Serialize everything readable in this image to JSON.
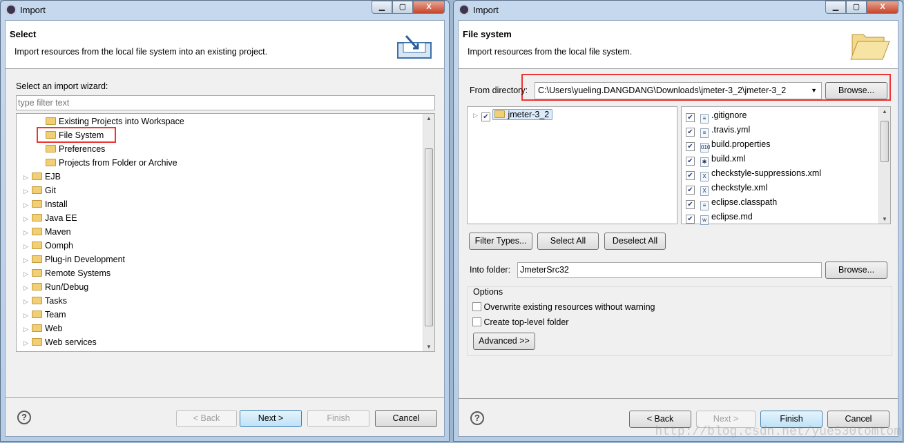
{
  "left": {
    "window_title": "Import",
    "header_title": "Select",
    "header_desc": "Import resources from the local file system into an existing project.",
    "wizard_label": "Select an import wizard:",
    "filter_placeholder": "type filter text",
    "tree": [
      {
        "label": "Existing Projects into Workspace",
        "child": true,
        "icon": "projects-icon"
      },
      {
        "label": "File System",
        "child": true,
        "icon": "folder-icon",
        "highlighted": true
      },
      {
        "label": "Preferences",
        "child": true,
        "icon": "preferences-icon"
      },
      {
        "label": "Projects from Folder or Archive",
        "child": true,
        "icon": "folder-icon"
      },
      {
        "label": "EJB"
      },
      {
        "label": "Git"
      },
      {
        "label": "Install"
      },
      {
        "label": "Java EE"
      },
      {
        "label": "Maven"
      },
      {
        "label": "Oomph"
      },
      {
        "label": "Plug-in Development"
      },
      {
        "label": "Remote Systems"
      },
      {
        "label": "Run/Debug"
      },
      {
        "label": "Tasks"
      },
      {
        "label": "Team"
      },
      {
        "label": "Web"
      },
      {
        "label": "Web services"
      }
    ],
    "buttons": {
      "back": "< Back",
      "next": "Next >",
      "finish": "Finish",
      "cancel": "Cancel"
    }
  },
  "right": {
    "window_title": "Import",
    "header_title": "File system",
    "header_desc": "Import resources from the local file system.",
    "from_dir_label": "From directory:",
    "from_dir_value": "C:\\Users\\yueling.DANGDANG\\Downloads\\jmeter-3_2\\jmeter-3_2",
    "browse": "Browse...",
    "folder_tree": [
      {
        "label": "jmeter-3_2",
        "checked": true
      }
    ],
    "files": [
      {
        "name": ".gitignore",
        "icon": "text-file-icon",
        "checked": true
      },
      {
        "name": ".travis.yml",
        "icon": "text-file-icon",
        "checked": true
      },
      {
        "name": "build.properties",
        "icon": "properties-file-icon",
        "checked": true
      },
      {
        "name": "build.xml",
        "icon": "ant-file-icon",
        "checked": true
      },
      {
        "name": "checkstyle-suppressions.xml",
        "icon": "xml-file-icon",
        "checked": true
      },
      {
        "name": "checkstyle.xml",
        "icon": "xml-file-icon",
        "checked": true
      },
      {
        "name": "eclipse.classpath",
        "icon": "text-file-icon",
        "checked": true
      },
      {
        "name": "eclipse.md",
        "icon": "word-file-icon",
        "checked": true
      }
    ],
    "filter_types": "Filter Types...",
    "select_all": "Select All",
    "deselect_all": "Deselect All",
    "into_folder_label": "Into folder:",
    "into_folder_value": "JmeterSrc32",
    "browse2": "Browse...",
    "options_label": "Options",
    "overwrite": "Overwrite existing resources without warning",
    "overwrite_checked": false,
    "create_top": "Create top-level folder",
    "create_top_checked": false,
    "advanced": "Advanced >>",
    "buttons": {
      "back": "< Back",
      "next": "Next >",
      "finish": "Finish",
      "cancel": "Cancel"
    }
  },
  "watermark": "http://blog.csdn.net/yue530tomtom",
  "colors": {
    "highlight": "#ee3333"
  }
}
